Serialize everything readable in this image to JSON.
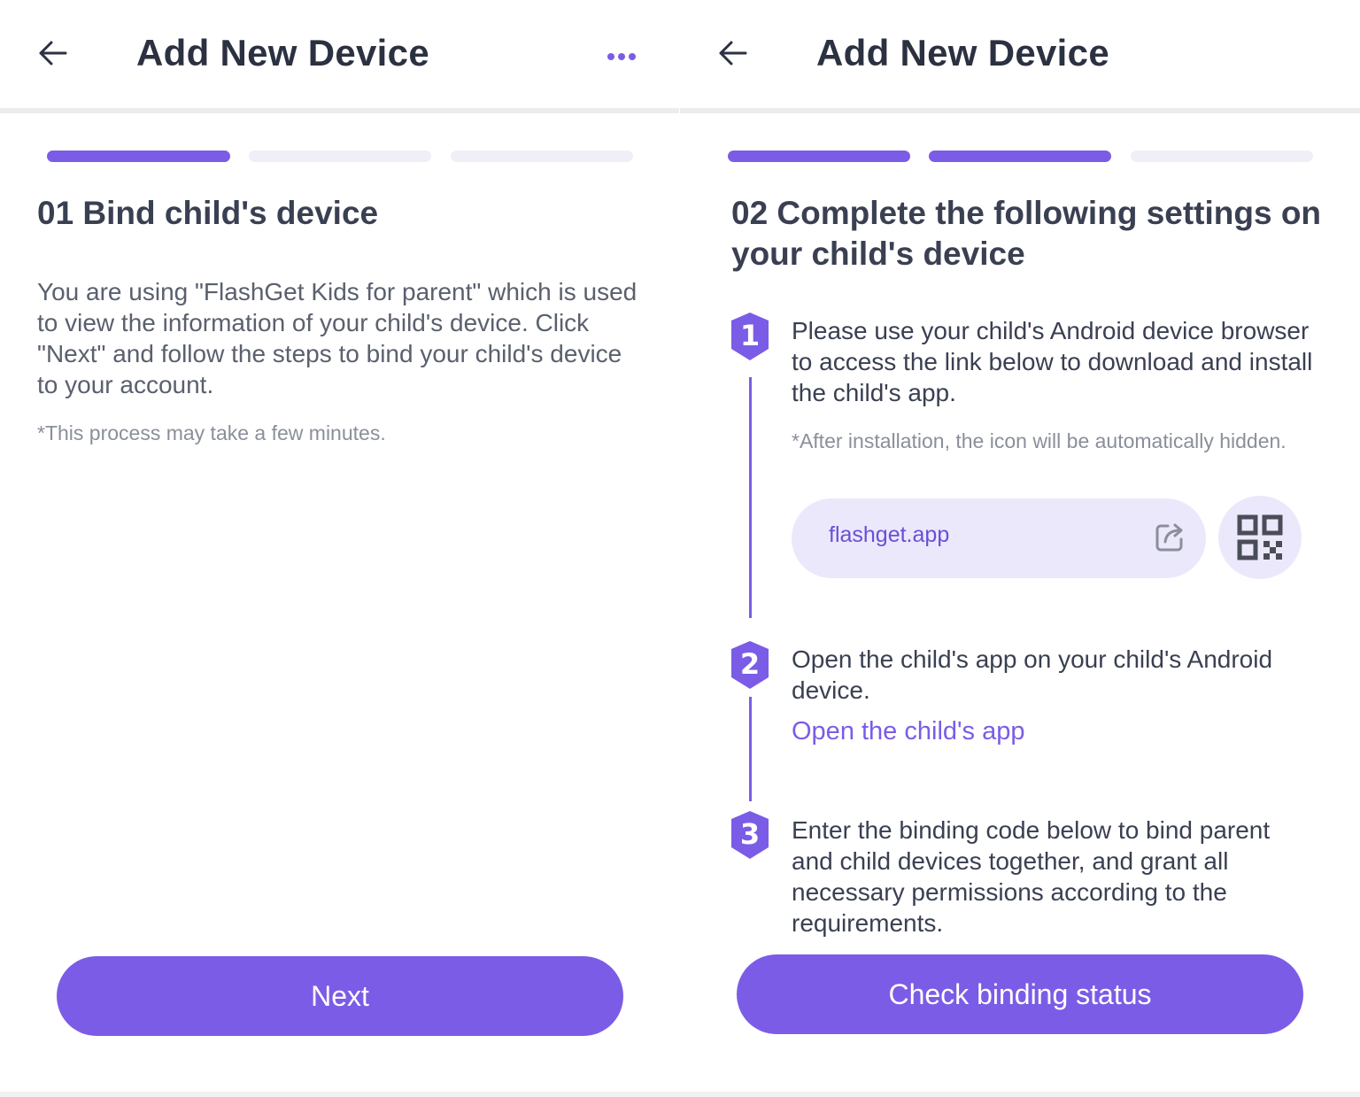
{
  "screen1": {
    "app_bar": {
      "title": "Add New Device",
      "back_icon": "back-arrow-icon",
      "more_icon": "more-dots-icon"
    },
    "progress": {
      "total_steps": 3,
      "current_step": 1
    },
    "heading": "01 Bind child's device",
    "description": "You are using \"FlashGet Kids for parent\" which is used to view the information of your child's device. Click \"Next\" and follow the steps to bind your child's device to your account.",
    "note": "*This process may take a few minutes.",
    "next_button": "Next"
  },
  "screen2": {
    "app_bar": {
      "title": "Add New Device",
      "back_icon": "back-arrow-icon"
    },
    "progress": {
      "total_steps": 3,
      "current_step": 2
    },
    "heading": "02 Complete the following settings on your child's device",
    "steps": [
      {
        "number": "1",
        "text": "Please use your child's Android device browser to access the link below to download and install the child's app.",
        "note": "*After installation, the icon will be automatically hidden.",
        "url": "flashget.app",
        "share_icon": "share-external-icon",
        "qr_icon": "qr-code-icon"
      },
      {
        "number": "2",
        "text": "Open the child's app on your child's Android device.",
        "link": "Open the child's app"
      },
      {
        "number": "3",
        "text": "Enter the binding code below to bind parent and child devices together, and grant all necessary permissions according to the requirements."
      }
    ],
    "check_button": "Check binding status"
  },
  "colors": {
    "accent": "#7b5ce6",
    "accent_light": "#ece8fb",
    "progress_inactive": "#f0eef6",
    "heading": "#3a4052",
    "body": "#5a606e",
    "note": "#8a8f9a"
  }
}
